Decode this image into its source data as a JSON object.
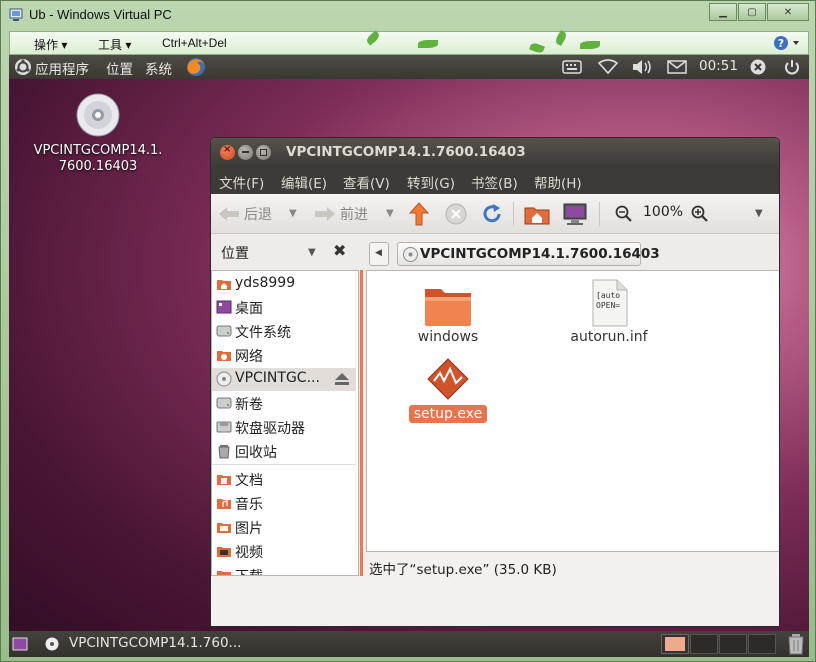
{
  "vpc": {
    "title": "Ub - Windows Virtual PC",
    "menu_action": "操作 ▾",
    "menu_tools": "工具 ▾",
    "menu_cad": "Ctrl+Alt+Del"
  },
  "panel": {
    "applications": "应用程序",
    "places": "位置",
    "system": "系统",
    "clock": "00:51"
  },
  "desktop": {
    "icon_label_line1": "VPCINTGCOMP14.1.",
    "icon_label_line2": "7600.16403"
  },
  "nautilus": {
    "title": "VPCINTGCOMP14.1.7600.16403",
    "menu": [
      "文件(F)",
      "编辑(E)",
      "查看(V)",
      "转到(G)",
      "书签(B)",
      "帮助(H)"
    ],
    "back_label": "后退",
    "forward_label": "前进",
    "zoom_level": "100%",
    "sidebar_header": "位置",
    "breadcrumb": "VPCINTGCOMP14.1.7600.16403",
    "sidebar_items": [
      "yds8999",
      "桌面",
      "文件系统",
      "网络",
      "VPCINTGC...",
      "新卷",
      "软盘驱动器",
      "回收站",
      "文档",
      "音乐",
      "图片",
      "视频",
      "下载"
    ],
    "files": [
      {
        "name": "windows",
        "type": "folder"
      },
      {
        "name": "autorun.inf",
        "type": "text",
        "preview": "[auto\nOPEN="
      },
      {
        "name": "setup.exe",
        "type": "exe"
      }
    ],
    "status": "选中了“setup.exe” (35.0 KB)"
  },
  "taskbar": {
    "task": "VPCINTGCOMP14.1.760..."
  },
  "colors": {
    "accent": "#e9734a",
    "panel": "#3c3b37"
  }
}
